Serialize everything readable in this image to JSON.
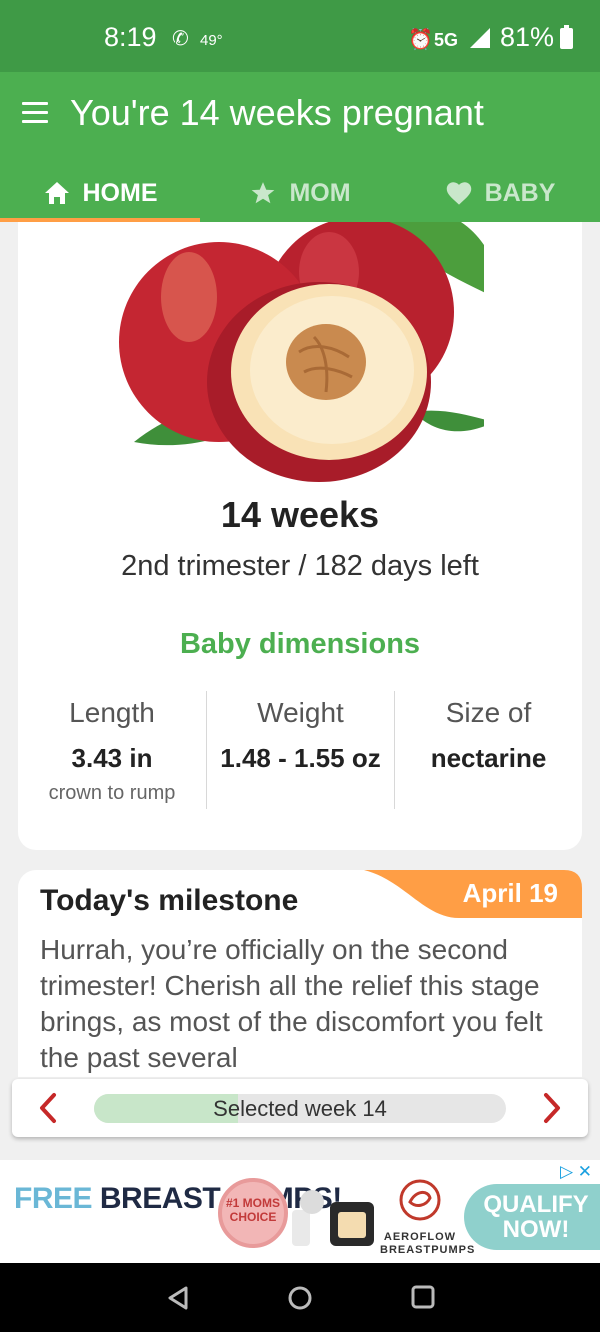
{
  "status_bar": {
    "time": "8:19",
    "temperature": "49°",
    "network": "5G",
    "battery": "81%"
  },
  "app_bar": {
    "title": "You're 14 weeks pregnant",
    "tabs": [
      {
        "label": "HOME",
        "icon": "home-icon",
        "active": true
      },
      {
        "label": "MOM",
        "icon": "star-icon",
        "active": false
      },
      {
        "label": "BABY",
        "icon": "heart-icon",
        "active": false
      }
    ]
  },
  "summary": {
    "image": "nectarine-illustration",
    "weeks": "14 weeks",
    "trimester_info": "2nd trimester / 182 days left",
    "dimensions_title": "Baby dimensions",
    "dimensions": [
      {
        "label": "Length",
        "value": "3.43 in",
        "sub": "crown to rump"
      },
      {
        "label": "Weight",
        "value": "1.48 - 1.55 oz",
        "sub": ""
      },
      {
        "label": "Size of",
        "value": "nectarine",
        "sub": ""
      }
    ]
  },
  "milestone": {
    "title": "Today's milestone",
    "date": "April 19",
    "text": "Hurrah, you’re officially on the second trimester! Cherish all the relief this stage brings, as most of the discomfort you felt the past several"
  },
  "week_selector": {
    "label": "Selected week 14",
    "progress": 0.35
  },
  "ad": {
    "headline_free": "FREE",
    "headline_rest": "BREAST PUMPS!",
    "badge": "#1 MOMS CHOICE",
    "brand": "AEROFLOW BREASTPUMPS",
    "cta": "QUALIFY NOW!"
  },
  "colors": {
    "primary": "#4caf50",
    "status_bar": "#3f9a46",
    "accent": "#ff9e45",
    "arrow": "#c62828"
  }
}
